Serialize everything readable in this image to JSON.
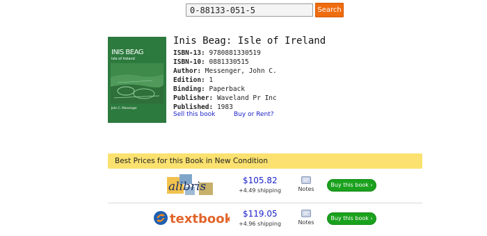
{
  "search": {
    "value": "0-88133-051-5",
    "button_label": "Search"
  },
  "book": {
    "cover": {
      "title": "INIS BEAG",
      "subtitle": "Isle of Ireland",
      "author": "John C. Messenger"
    },
    "title": "Inis Beag: Isle of Ireland",
    "details": [
      {
        "label": "ISBN-13:",
        "value": "9780881330519"
      },
      {
        "label": "ISBN-10:",
        "value": "0881330515"
      },
      {
        "label": "Author:",
        "value": "Messenger, John C."
      },
      {
        "label": "Edition:",
        "value": "1"
      },
      {
        "label": "Binding:",
        "value": "Paperback"
      },
      {
        "label": "Publisher:",
        "value": "Waveland Pr Inc"
      },
      {
        "label": "Published:",
        "value": "1983"
      }
    ],
    "sell_link": "Sell this book",
    "buy_link": "Buy or Rent?"
  },
  "prices": {
    "header": "Best Prices for this Book in New Condition",
    "offers": [
      {
        "seller": "alibris",
        "price": "$105.82",
        "shipping": "+4.49 shipping",
        "notes_label": "Notes",
        "button_label": "Buy this book ›"
      },
      {
        "seller": "textbookx",
        "price": "$119.05",
        "shipping": "+4.96 shipping",
        "notes_label": "Notes",
        "button_label": "Buy this book ›"
      }
    ]
  },
  "colors": {
    "accent": "#ef6c0f",
    "header_bg": "#fbe16f",
    "link": "#1a21c8",
    "buy_button": "#1aa11d",
    "cover_bg": "#2c7a3e"
  }
}
